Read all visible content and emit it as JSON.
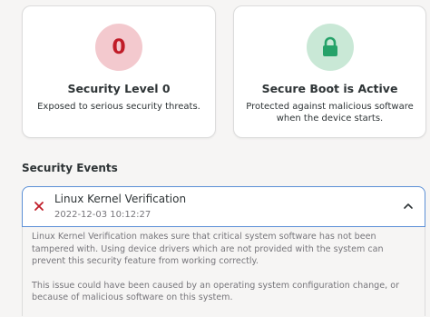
{
  "cards": [
    {
      "title": "Security Level 0",
      "description": "Exposed to serious security threats.",
      "icon": "security-level-zero-icon",
      "icon_text": "0",
      "icon_bg": "#f3c9ce",
      "icon_fg": "#c01c28"
    },
    {
      "title": "Secure Boot is Active",
      "description": "Protected against malicious software when the device starts.",
      "icon": "lock-icon",
      "icon_bg": "#c9e8d6",
      "icon_fg": "#26a269"
    }
  ],
  "events": {
    "section_title": "Security Events",
    "items": [
      {
        "title": "Linux Kernel Verification",
        "timestamp": "2022-12-03 10:12:27",
        "status": "failed",
        "status_color": "#c01c28",
        "expanded": true,
        "body_paragraph_1": "Linux Kernel Verification makes sure that critical system software has not been tampered with. Using device drivers which are not provided with the system can prevent this security feature from working correctly.",
        "body_paragraph_2": "This issue could have been caused by an operating system configuration change, or because of malicious software on this system."
      }
    ]
  },
  "colors": {
    "accent": "#3584e4",
    "danger": "#c01c28",
    "success": "#26a269"
  }
}
